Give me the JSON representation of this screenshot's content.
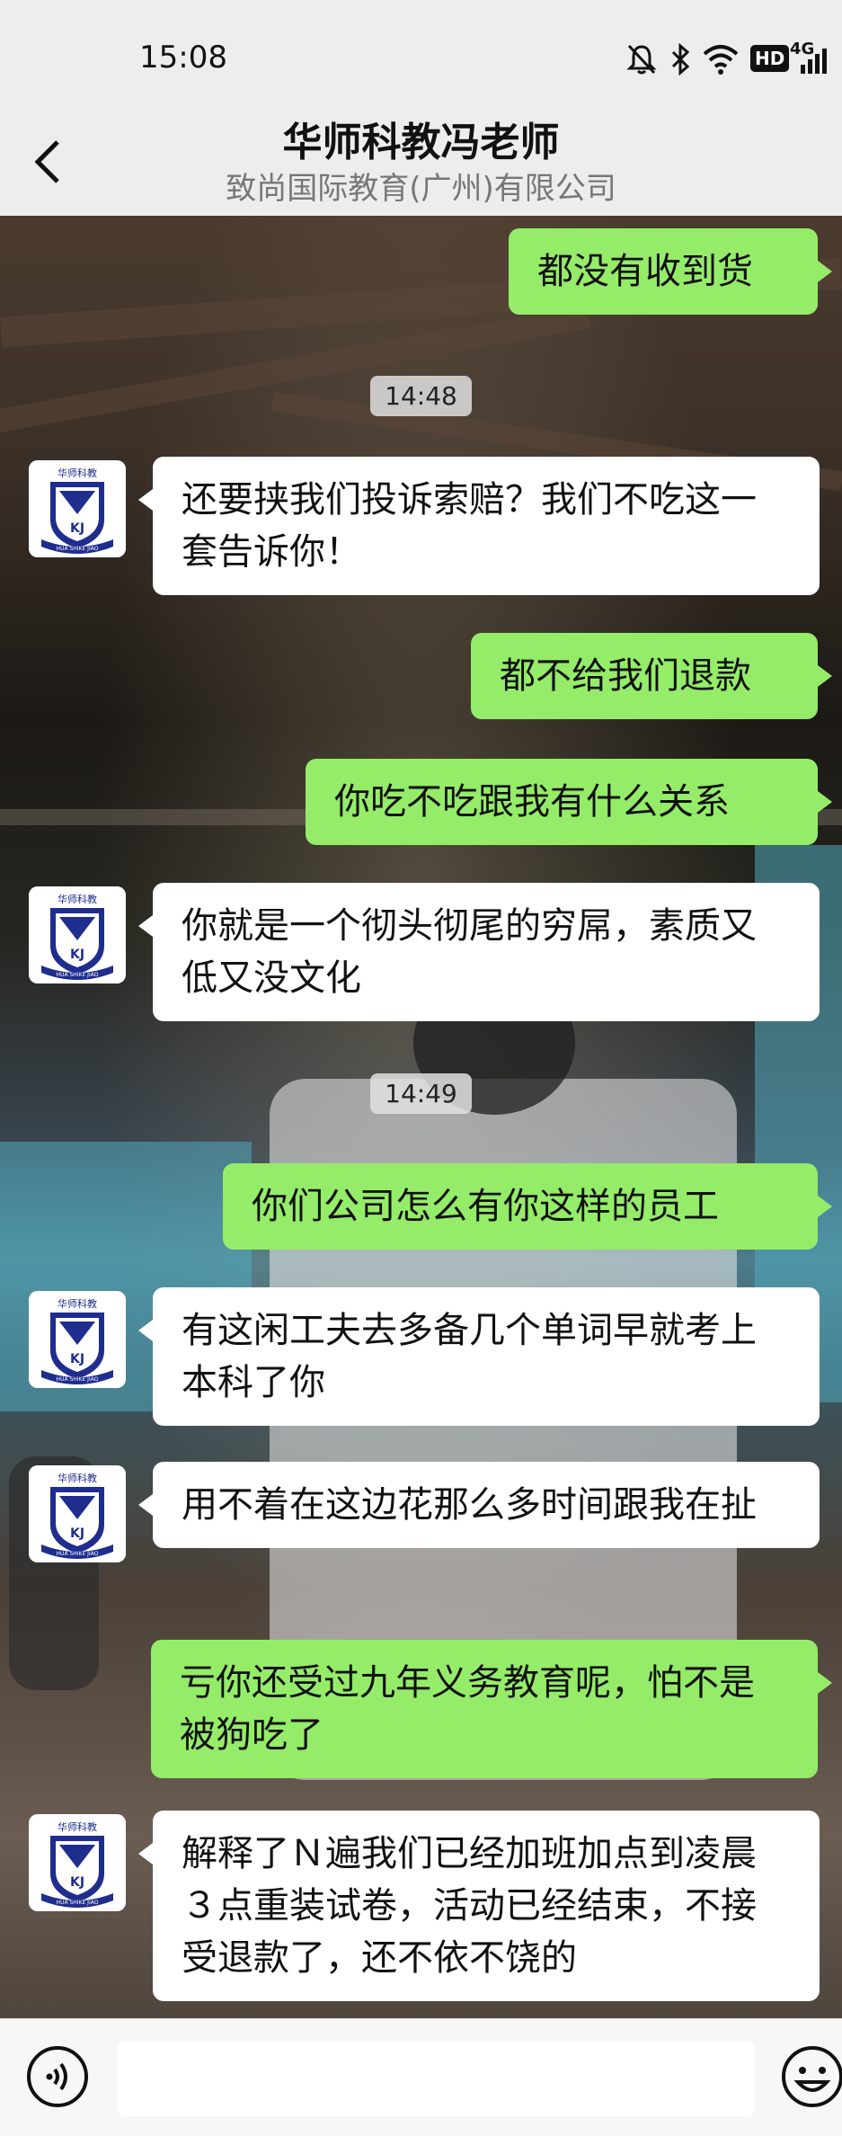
{
  "status_bar": {
    "time": "15:08",
    "icons": [
      "mute-bell-icon",
      "bluetooth-icon",
      "wifi-icon",
      "hd-icon",
      "4g-signal-icon"
    ],
    "hd_label": "HD",
    "network_label": "4G"
  },
  "header": {
    "back_icon": "chevron-left-icon",
    "title": "华师科教冯老师",
    "subtitle": "致尚国际教育(广州)有限公司"
  },
  "avatar": {
    "logo_top": "华师科教",
    "logo_initials": "KJ",
    "logo_ribbon": "HUA SHIKE JIAO"
  },
  "messages": [
    {
      "type": "out",
      "text": "都没有收到货"
    },
    {
      "type": "time",
      "text": "14:48"
    },
    {
      "type": "in",
      "text": "还要挟我们投诉索赔？我们不吃这一套告诉你！"
    },
    {
      "type": "out",
      "text": "都不给我们退款"
    },
    {
      "type": "out",
      "text": "你吃不吃跟我有什么关系"
    },
    {
      "type": "in",
      "text": "你就是一个彻头彻尾的穷屌，素质又低又没文化"
    },
    {
      "type": "time",
      "text": "14:49"
    },
    {
      "type": "out",
      "text": "你们公司怎么有你这样的员工"
    },
    {
      "type": "in",
      "text": "有这闲工夫去多备几个单词早就考上本科了你"
    },
    {
      "type": "in",
      "text": "用不着在这边花那么多时间跟我在扯"
    },
    {
      "type": "out",
      "text": "亏你还受过九年义务教育呢，怕不是被狗吃了"
    },
    {
      "type": "in",
      "text": "解释了Ｎ遍我们已经加班加点到凌晨３点重装试卷，活动已经结束，不接受退款了，还不依不饶的"
    }
  ],
  "input_bar": {
    "voice_icon": "voice-icon",
    "emoji_icon": "emoji-icon",
    "placeholder": ""
  },
  "colors": {
    "outgoing_bubble": "#95ec69",
    "incoming_bubble": "#ffffff",
    "header_bg": "#ededed"
  }
}
